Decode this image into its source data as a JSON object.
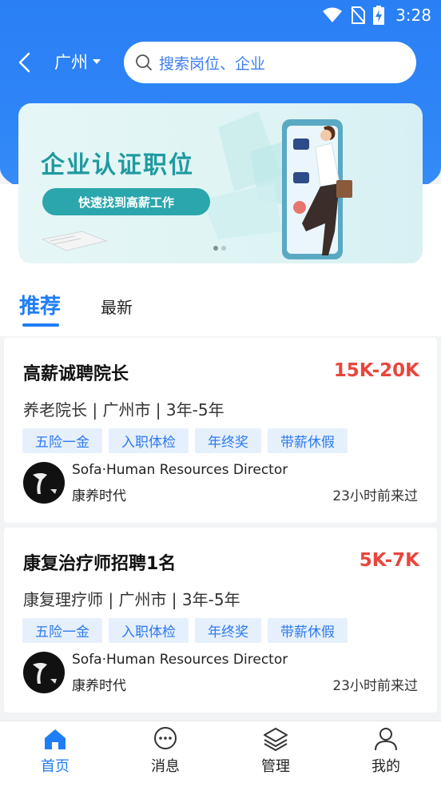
{
  "status_bar": {
    "time": "3:28"
  },
  "header": {
    "city": "广州",
    "search_placeholder": "搜索岗位、企业"
  },
  "banner": {
    "title": "企业认证职位",
    "subtitle": "快速找到高薪工作",
    "page_count": 2,
    "active_page": 1
  },
  "tabs": [
    {
      "label": "推荐",
      "active": true
    },
    {
      "label": "最新",
      "active": false
    }
  ],
  "jobs": [
    {
      "title": "高薪诚聘院长",
      "salary": "15K-20K",
      "meta": "养老院长 |  广州市 |  3年-5年",
      "tags": [
        "五险一金",
        "入职体检",
        "年终奖",
        "带薪休假"
      ],
      "recruiter": "Sofa·Human Resources Director",
      "company": "康养时代",
      "last_seen": "23小时前来过"
    },
    {
      "title": "康复治疗师招聘1名",
      "salary": "5K-7K",
      "meta": "康复理疗师 |  广州市 |  3年-5年",
      "tags": [
        "五险一金",
        "入职体检",
        "年终奖",
        "带薪休假"
      ],
      "recruiter": "Sofa·Human Resources Director",
      "company": "康养时代",
      "last_seen": "23小时前来过"
    }
  ],
  "bottom_nav": [
    {
      "label": "首页",
      "icon": "home-icon",
      "active": true
    },
    {
      "label": "消息",
      "icon": "chat-icon",
      "active": false
    },
    {
      "label": "管理",
      "icon": "layers-icon",
      "active": false
    },
    {
      "label": "我的",
      "icon": "user-icon",
      "active": false
    }
  ],
  "colors": {
    "primary": "#1f7ef5",
    "salary": "#e8463c",
    "tag_bg": "#e6f0fd",
    "banner_accent": "#2aa6ac"
  }
}
